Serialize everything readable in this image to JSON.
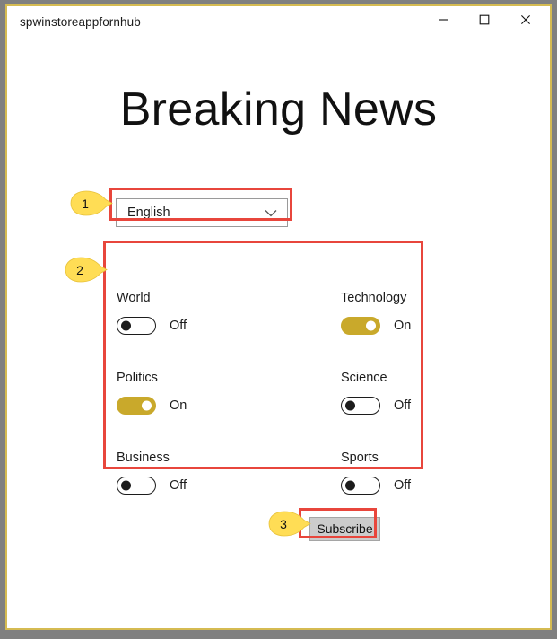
{
  "window": {
    "title": "spwinstoreappfornhub",
    "border_color": "#d5bb52",
    "controls": {
      "minimize": "minimize-icon",
      "maximize": "maximize-icon",
      "close": "close-icon"
    }
  },
  "page": {
    "heading": "Breaking News"
  },
  "language": {
    "selected": "English",
    "chevron": "chevron-down-icon",
    "options": [
      "English"
    ]
  },
  "topics": [
    {
      "label": "World",
      "state": "Off",
      "on": false
    },
    {
      "label": "Technology",
      "state": "On",
      "on": true
    },
    {
      "label": "Politics",
      "state": "On",
      "on": true
    },
    {
      "label": "Science",
      "state": "Off",
      "on": false
    },
    {
      "label": "Business",
      "state": "Off",
      "on": false
    },
    {
      "label": "Sports",
      "state": "Off",
      "on": false
    }
  ],
  "actions": {
    "subscribe_label": "Subscribe"
  },
  "annotations": {
    "box_color": "#e8463c",
    "badge_color": "#ffdd55",
    "callouts": [
      {
        "number": "1",
        "target": "language-dropdown"
      },
      {
        "number": "2",
        "target": "topics-grid"
      },
      {
        "number": "3",
        "target": "subscribe-button"
      }
    ]
  },
  "colors": {
    "toggle_on": "#c9a92b",
    "toggle_off_outline": "#1c1c1c",
    "button_face": "#cccccc"
  }
}
